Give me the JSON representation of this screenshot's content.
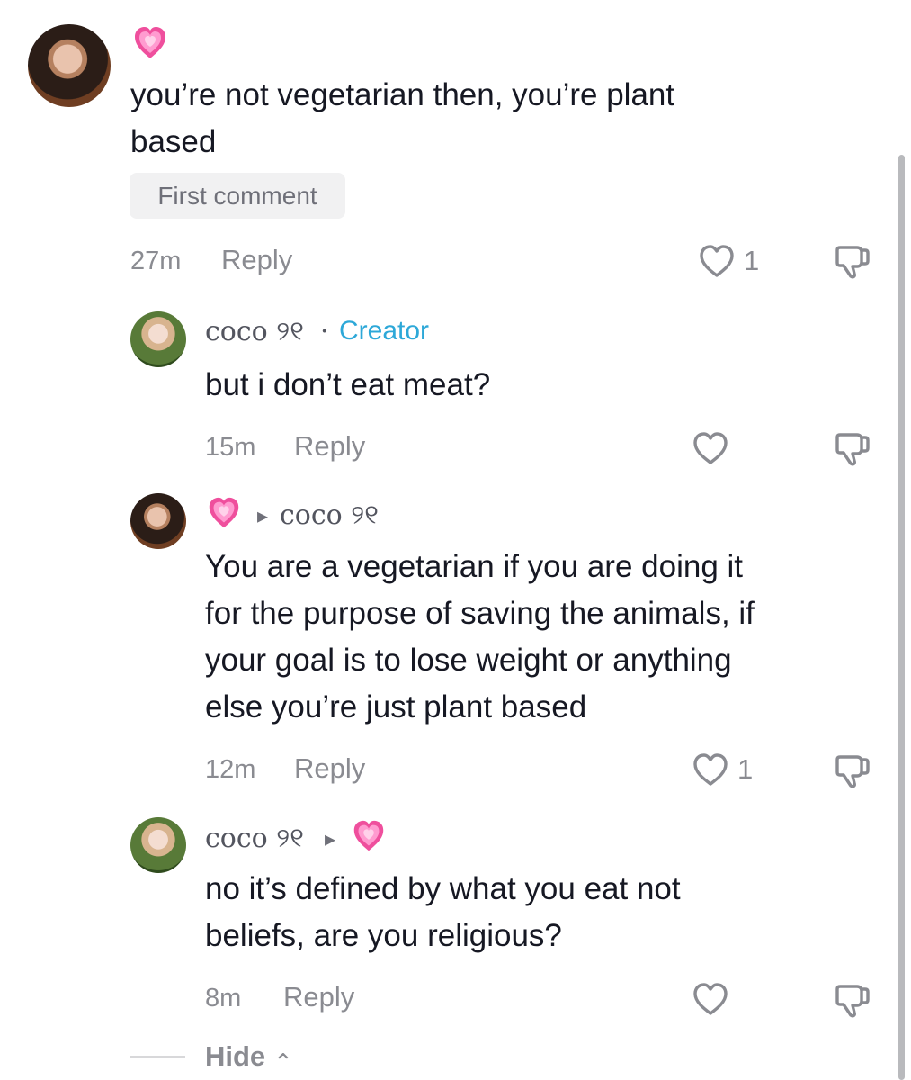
{
  "comments": [
    {
      "text_lines": [
        "you’re not vegetarian then, you’re plant",
        "based"
      ],
      "badge": "First comment",
      "time": "27m",
      "reply": "Reply",
      "likes": "1"
    },
    {
      "user": "coco ୨୧",
      "separator": "·",
      "role": "Creator",
      "text_lines": [
        "but i don’t eat meat?"
      ],
      "time": "15m",
      "reply": "Reply"
    },
    {
      "reply_arrow": "▸",
      "reply_to": "coco ୨୧",
      "text_lines": [
        "You are a vegetarian if you are doing it",
        "for the purpose of saving the animals, if",
        "your goal is to lose weight or anything",
        "else you’re just plant based"
      ],
      "time": "12m",
      "reply": "Reply",
      "likes": "1"
    },
    {
      "user": "coco ୨୧",
      "reply_arrow": "▸",
      "text_lines": [
        "no it’s defined by what you eat not",
        "beliefs, are you religious?"
      ],
      "time": "8m",
      "reply": "Reply"
    }
  ],
  "hide": {
    "label": "Hide",
    "chevron": "⌃"
  },
  "icons": {
    "heart_emoji": "pink-heart-emoji",
    "like": "heart-outline-icon",
    "dislike": "thumbs-down-icon"
  },
  "colors": {
    "creator": "#2da8d8",
    "meta": "#8a8b91",
    "pink": "#ef5aa8"
  }
}
